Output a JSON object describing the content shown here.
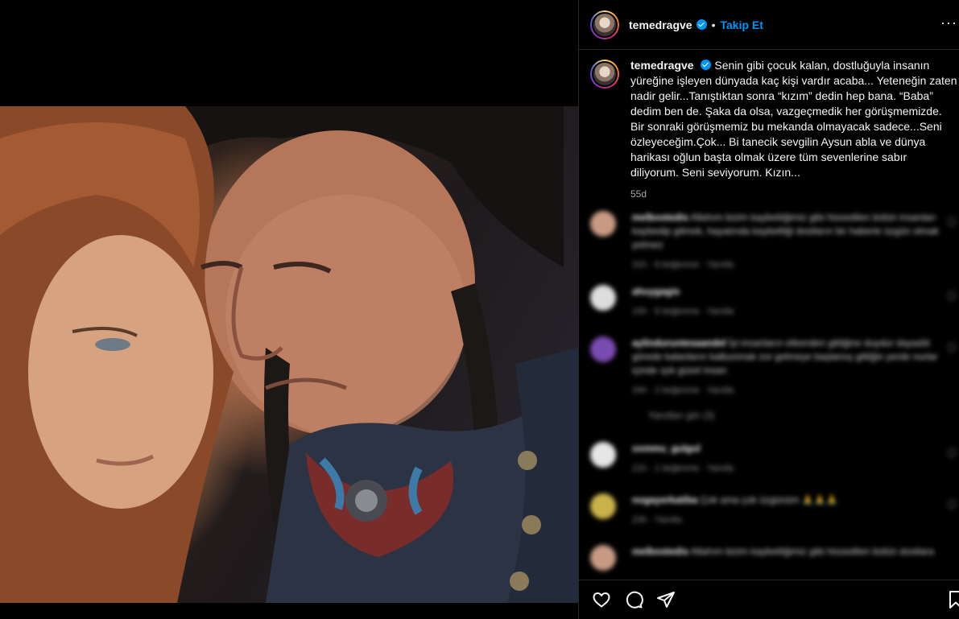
{
  "post": {
    "username": "temedragve",
    "follow_label": "Takip Et",
    "more_icon": "more-horizontal-icon",
    "caption_text": "Senin gibi çocuk kalan, dostluğuyla insanın yüreğine işleyen dünyada kaç kişi vardır acaba... Yeteneğin zaten nadir gelir...Tanıştıktan sonra “kızım” dedin hep bana. “Baba” dedim ben de. Şaka da olsa, vazgeçmedik her görüşmemizde. Bir sonraki görüşmemiz bu mekanda olmayacak sadece...Seni özleyeceğim.Çok... Bi tanecik sevgilin Aysun abla ve dünya harikası oğlun başta olmak üzere tüm sevenlerine sabır diliyorum. Seni seviyorum. Kızın...",
    "age": "55d"
  },
  "comments": [
    {
      "user": "melbostedis",
      "text": "Allahım bizim kaybettiğimiz gibi hissedilen bütün insanları kaybedip gitmek, hayatında kaybettiği dostların bir haberle üzgün olmak yetmez",
      "meta": "31h · 8 beğenme · Yanıtla"
    },
    {
      "user": "ahuygagis",
      "text": "",
      "meta": "15h · 8 beğenme · Yanıtla"
    },
    {
      "user": "aylinduruntesaandel",
      "text": "İyi insanların etkenden gittiğine duydur dayadık görede kalanların kalbunmak zor gelmeye başlamış gittiğin yerde nurlar içinde ışık güzel insan",
      "meta": "34h · 2 beğenme · Yanıtla"
    },
    {
      "user": "",
      "text": "Yanıtları gör (3)",
      "meta": ""
    },
    {
      "user": "xxmmu_gulgul",
      "text": "",
      "meta": "21h · 1 beğenme · Yanıtla"
    },
    {
      "user": "nogayerkatiba",
      "text": "Çok ama çok üzgünüm 🙏🙏🙏",
      "meta": "23h · Yanıtla"
    },
    {
      "user": "melbostedis",
      "text": "Allahım bizim kaybettiğimiz gibi hissedilen bütün dostlara",
      "meta": ""
    }
  ],
  "actions": {
    "like_icon": "heart-icon",
    "comment_icon": "comment-icon",
    "share_icon": "share-icon",
    "save_icon": "bookmark-icon"
  },
  "colors": {
    "background": "#000000",
    "accent": "#0095f6",
    "text": "#f5f5f5",
    "muted": "#a8a8a8",
    "divider": "#262626"
  }
}
